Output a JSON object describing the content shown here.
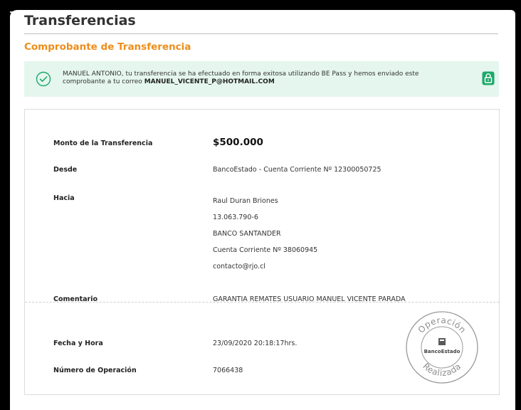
{
  "header": {
    "title": "Transferencias",
    "subtitle": "Comprobante de Transferencia"
  },
  "notice": {
    "message_line1": "MANUEL ANTONIO, tu transferencia se ha efectuado en forma exitosa utilizando BE Pass y hemos enviado este",
    "message_line2_prefix": "comprobante a tu correo ",
    "email": "MANUEL_VICENTE_P@HOTMAIL.COM",
    "status_icon": "check-circle-icon",
    "lock_icon": "lock-icon",
    "colors": {
      "background": "#e5f6ee",
      "accent": "#1ea86a"
    }
  },
  "receipt": {
    "amount_label": "Monto de la Transferencia",
    "amount_value": "$500.000",
    "from_label": "Desde",
    "from_value": "BancoEstado - Cuenta Corriente Nº 12300050725",
    "to_label": "Hacia",
    "to_lines": [
      "Raul Duran Briones",
      "13.063.790-6",
      "BANCO SANTANDER",
      "Cuenta Corriente Nº 38060945",
      "contacto@rjo.cl"
    ],
    "comment_label": "Comentario",
    "comment_value": "GARANTIA REMATES USUARIO MANUEL VICENTE PARADA",
    "datetime_label": "Fecha y Hora",
    "datetime_value": "23/09/2020 20:18:17hrs.",
    "operation_label": "Número de Operación",
    "operation_value": "7066438"
  },
  "stamp": {
    "top_text": "Operación",
    "bottom_text": "Realizada",
    "brand": "BancoEstado"
  },
  "colors": {
    "section_title": "#ee8d1a",
    "check_green": "#1ea86a"
  }
}
